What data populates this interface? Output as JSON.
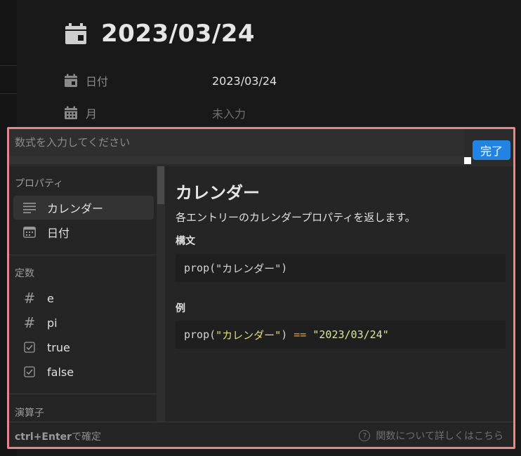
{
  "page": {
    "title": "2023/03/24",
    "properties": [
      {
        "label": "日付",
        "value": "2023/03/24"
      },
      {
        "label": "月",
        "value": "未入力"
      }
    ]
  },
  "editor": {
    "placeholder": "数式を入力してください",
    "done_label": "完了",
    "sections": [
      {
        "label": "プロパティ",
        "items": [
          {
            "label": "カレンダー",
            "icon": "text-lines-icon",
            "selected": true
          },
          {
            "label": "日付",
            "icon": "calendar-icon"
          }
        ]
      },
      {
        "label": "定数",
        "items": [
          {
            "label": "e",
            "icon": "hash-icon"
          },
          {
            "label": "pi",
            "icon": "hash-icon"
          },
          {
            "label": "true",
            "icon": "checkbox-icon"
          },
          {
            "label": "false",
            "icon": "checkbox-icon"
          }
        ]
      },
      {
        "label": "演算子"
      }
    ],
    "doc": {
      "title": "カレンダー",
      "description": "各エントリーのカレンダープロパティを返します。",
      "syntax_heading": "構文",
      "syntax": {
        "prefix": "prop(",
        "string": "\"カレンダー\"",
        "suffix": ")"
      },
      "example_heading": "例",
      "example": {
        "prefix": "prop(",
        "string": "\"カレンダー\"",
        "close": ") ",
        "op": "==",
        "space": " ",
        "value": "\"2023/03/24\""
      }
    },
    "footer": {
      "hint_key": "ctrl+Enter",
      "hint_text": "で確定",
      "help_link": "関数について詳しくはこちら",
      "help_icon_glyph": "?"
    }
  },
  "colors": {
    "accent": "#2383e2",
    "highlight_border": "#e8868a",
    "background": "#191919"
  }
}
